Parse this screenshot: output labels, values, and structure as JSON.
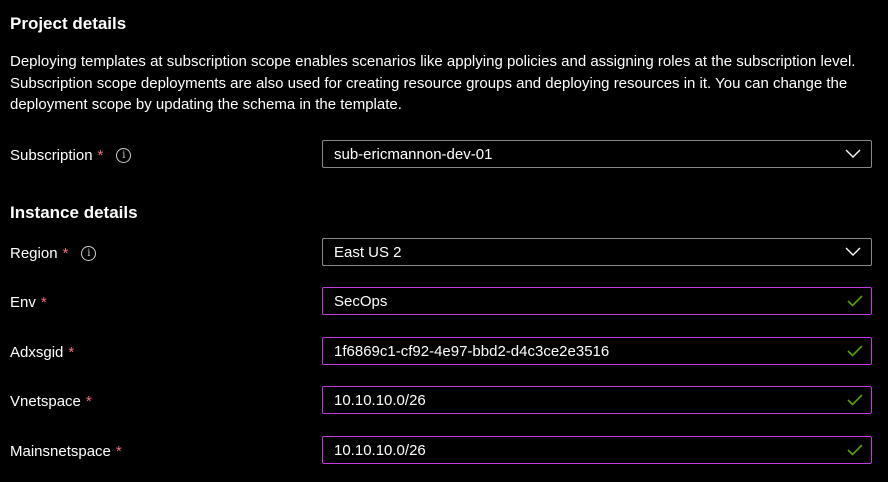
{
  "project": {
    "title": "Project details",
    "description": "Deploying templates at subscription scope enables scenarios like applying policies and assigning roles at the subscription level. Subscription scope deployments are also used for creating resource groups and deploying resources in it. You can change the deployment scope by updating the schema in the template.",
    "subscription": {
      "label": "Subscription",
      "required": "*",
      "info_icon": "info-icon",
      "value": "sub-ericmannon-dev-01"
    }
  },
  "instance": {
    "title": "Instance details",
    "region": {
      "label": "Region",
      "required": "*",
      "info_icon": "info-icon",
      "value": "East US 2"
    },
    "env": {
      "label": "Env",
      "required": "*",
      "value": "SecOps",
      "valid_icon": "checkmark-icon"
    },
    "adxsgid": {
      "label": "Adxsgid",
      "required": "*",
      "value": "1f6869c1-cf92-4e97-bbd2-d4c3ce2e3516",
      "valid_icon": "checkmark-icon"
    },
    "vnetspace": {
      "label": "Vnetspace",
      "required": "*",
      "value": "10.10.10.0/26",
      "valid_icon": "checkmark-icon"
    },
    "mainsnetspace": {
      "label": "Mainsnetspace",
      "required": "*",
      "value": "10.10.10.0/26",
      "valid_icon": "checkmark-icon"
    }
  },
  "colors": {
    "background": "#000000",
    "text": "#ffffff",
    "required_asterisk": "#f1707b",
    "select_border": "#8a8886",
    "focused_input_border": "#c239e0",
    "valid_check": "#57a300"
  }
}
